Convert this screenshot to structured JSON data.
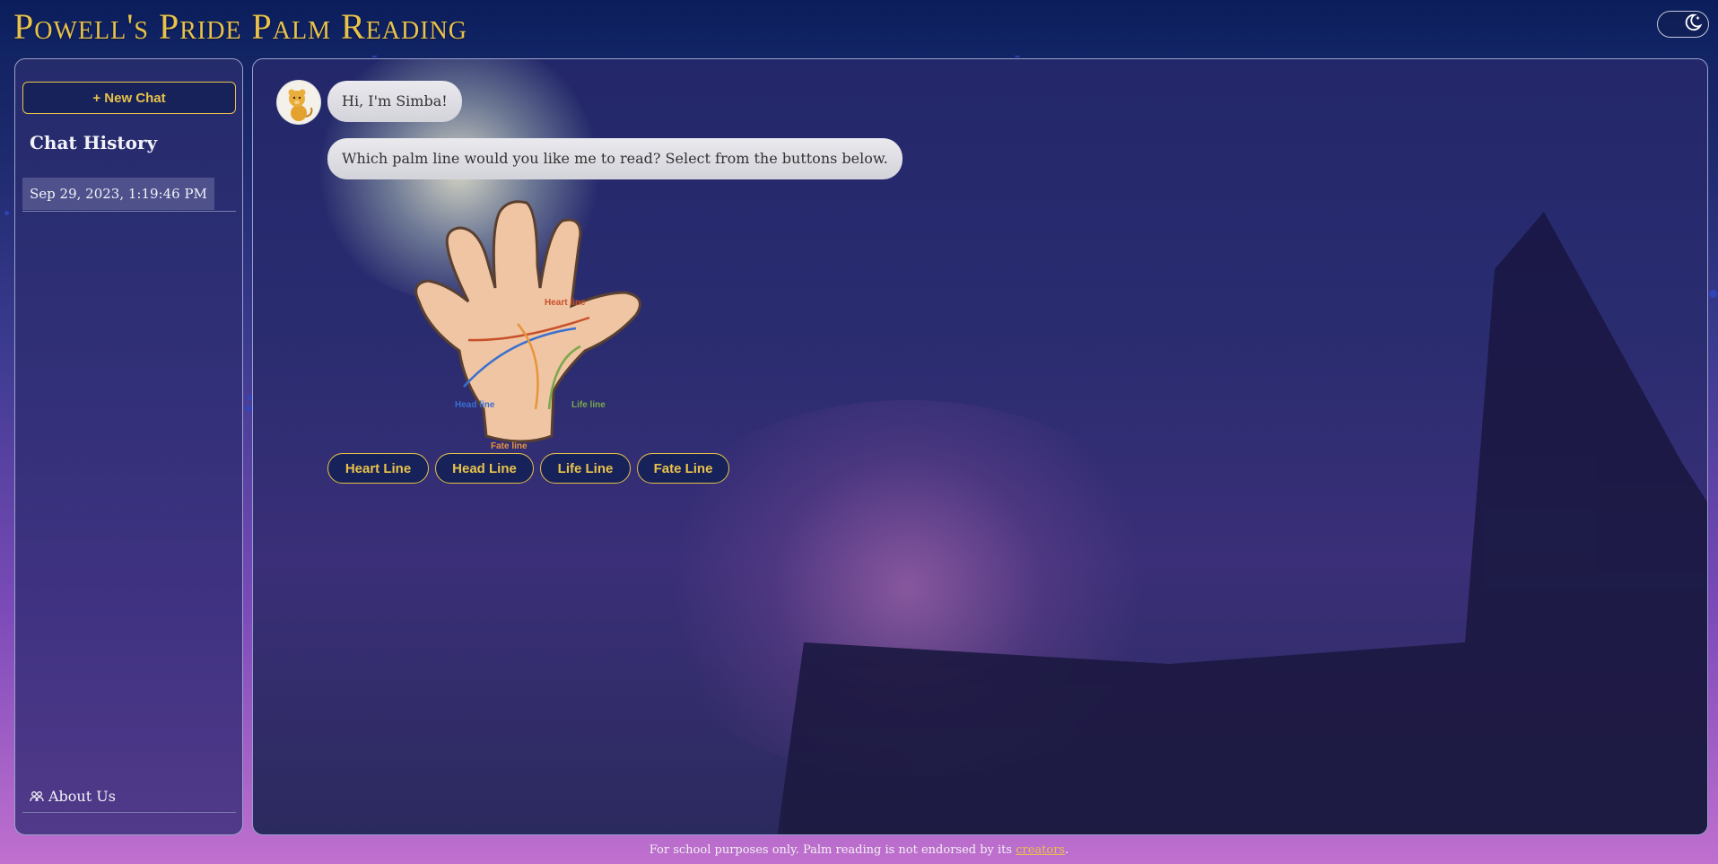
{
  "app": {
    "title": "Powell's Pride Palm Reading"
  },
  "header": {
    "theme_toggle_icon": "moon-star-icon"
  },
  "sidebar": {
    "new_chat_label": "+ New Chat",
    "history_title": "Chat History",
    "history_items": [
      {
        "label": "Sep 29, 2023, 1:19:46 PM"
      }
    ],
    "about_label": "About Us",
    "about_icon": "people-icon"
  },
  "chat": {
    "messages": [
      {
        "sender": "Simba",
        "text": "Hi, I'm Simba!"
      },
      {
        "sender": "Simba",
        "text": "Which palm line would you like me to read? Select from the buttons below."
      }
    ],
    "palm_diagram": {
      "labels": {
        "heart": "Heart line",
        "head": "Head line",
        "life": "Life line",
        "fate": "Fate line"
      },
      "colors": {
        "heart": "#c8502a",
        "head": "#3a6fd0",
        "life": "#7aa84a",
        "fate": "#e8953a"
      }
    },
    "line_buttons": [
      {
        "label": "Heart Line"
      },
      {
        "label": "Head Line"
      },
      {
        "label": "Life Line"
      },
      {
        "label": "Fate Line"
      }
    ]
  },
  "footer": {
    "text": "For school purposes only. Palm reading is not endorsed by its ",
    "link_label": "creators",
    "suffix": "."
  },
  "colors": {
    "accent_gold": "#e8c24a",
    "button_bg": "#17225a"
  }
}
